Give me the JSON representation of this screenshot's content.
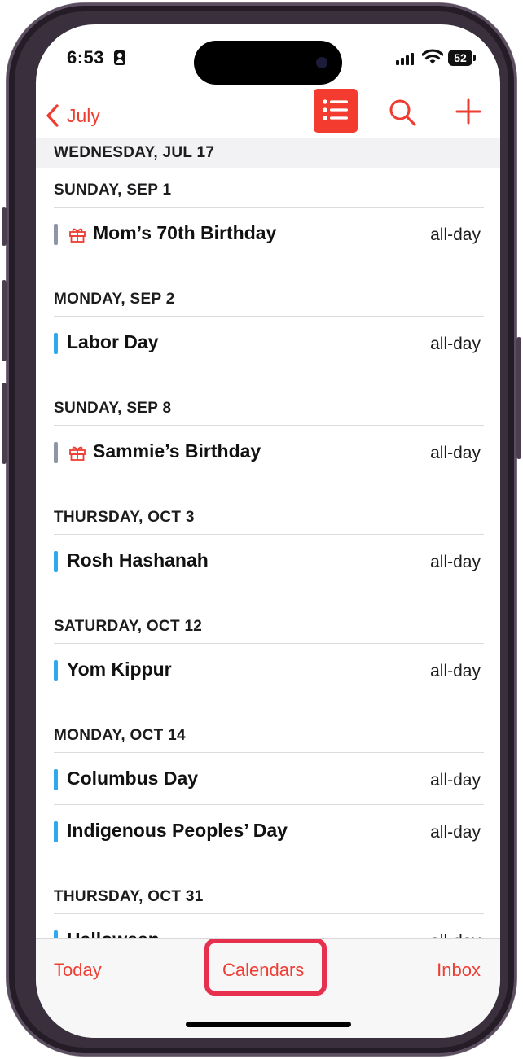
{
  "status": {
    "time": "6:53",
    "battery": "52"
  },
  "nav": {
    "back_label": "July"
  },
  "list": {
    "sticky_header": "WEDNESDAY, JUL 17",
    "sections": [
      {
        "date": "SUNDAY, SEP 1",
        "events": [
          {
            "title": "Mom’s 70th Birthday",
            "time": "all-day"
          }
        ]
      },
      {
        "date": "MONDAY, SEP 2",
        "events": [
          {
            "title": "Labor Day",
            "time": "all-day"
          }
        ]
      },
      {
        "date": "SUNDAY, SEP 8",
        "events": [
          {
            "title": "Sammie’s Birthday",
            "time": "all-day"
          }
        ]
      },
      {
        "date": "THURSDAY, OCT 3",
        "events": [
          {
            "title": "Rosh Hashanah",
            "time": "all-day"
          }
        ]
      },
      {
        "date": "SATURDAY, OCT 12",
        "events": [
          {
            "title": "Yom Kippur",
            "time": "all-day"
          }
        ]
      },
      {
        "date": "MONDAY, OCT 14",
        "events": [
          {
            "title": "Columbus Day",
            "time": "all-day"
          },
          {
            "title": "Indigenous Peoples’ Day",
            "time": "all-day"
          }
        ]
      },
      {
        "date": "THURSDAY, OCT 31",
        "events": [
          {
            "title": "Halloween",
            "time": "all-day"
          }
        ]
      }
    ]
  },
  "tabs": {
    "today": "Today",
    "calendars": "Calendars",
    "inbox": "Inbox"
  },
  "colors": {
    "accent": "#ee3d32",
    "holiday_bar": "#2fa8ee",
    "birthday_bar": "#8e95a6",
    "highlight": "#e6304e"
  }
}
